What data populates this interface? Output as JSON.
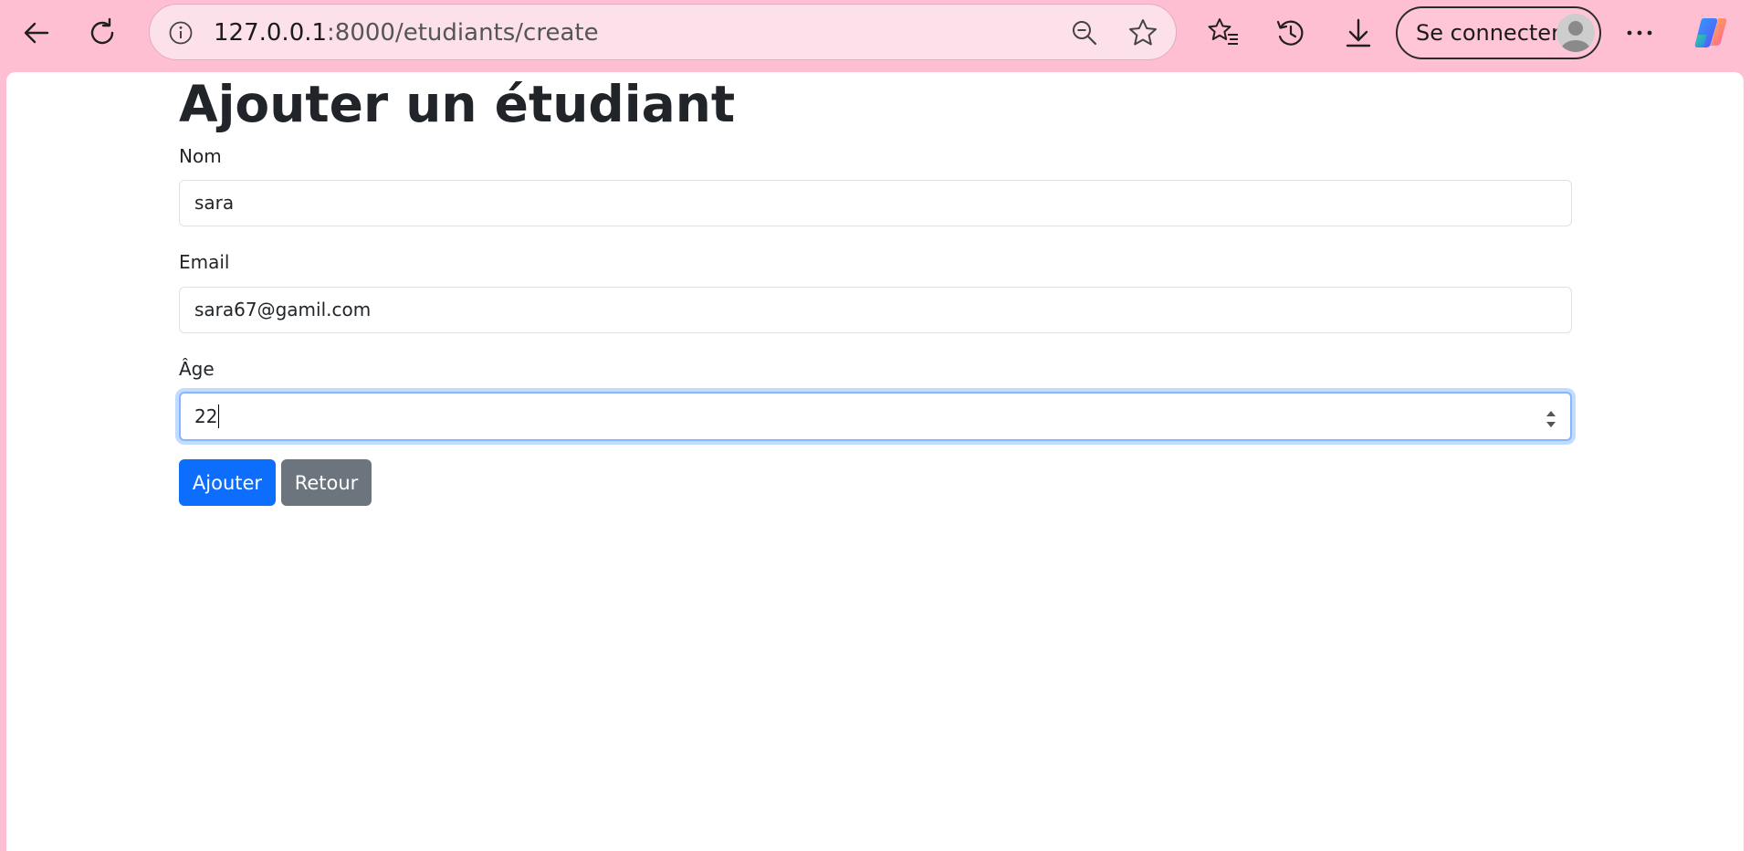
{
  "browser": {
    "url_host": "127.0.0.1",
    "url_path": ":8000/etudiants/create",
    "signin_label": "Se connecter",
    "icons": [
      "back-icon",
      "refresh-icon",
      "info-icon",
      "zoom-out-icon",
      "star-icon",
      "favorites-icon",
      "history-icon",
      "download-icon",
      "avatar",
      "more-icon",
      "copilot-icon"
    ]
  },
  "page": {
    "title": "Ajouter un étudiant",
    "form": {
      "nom": {
        "label": "Nom",
        "value": "sara"
      },
      "email": {
        "label": "Email",
        "value": "sara67@gamil.com"
      },
      "age": {
        "label": "Âge",
        "value": "22"
      }
    },
    "buttons": {
      "submit": "Ajouter",
      "back": "Retour"
    },
    "colors": {
      "primary": "#0d6efd",
      "secondary": "#6c757d",
      "browser_frame": "#ffbfd3"
    }
  }
}
